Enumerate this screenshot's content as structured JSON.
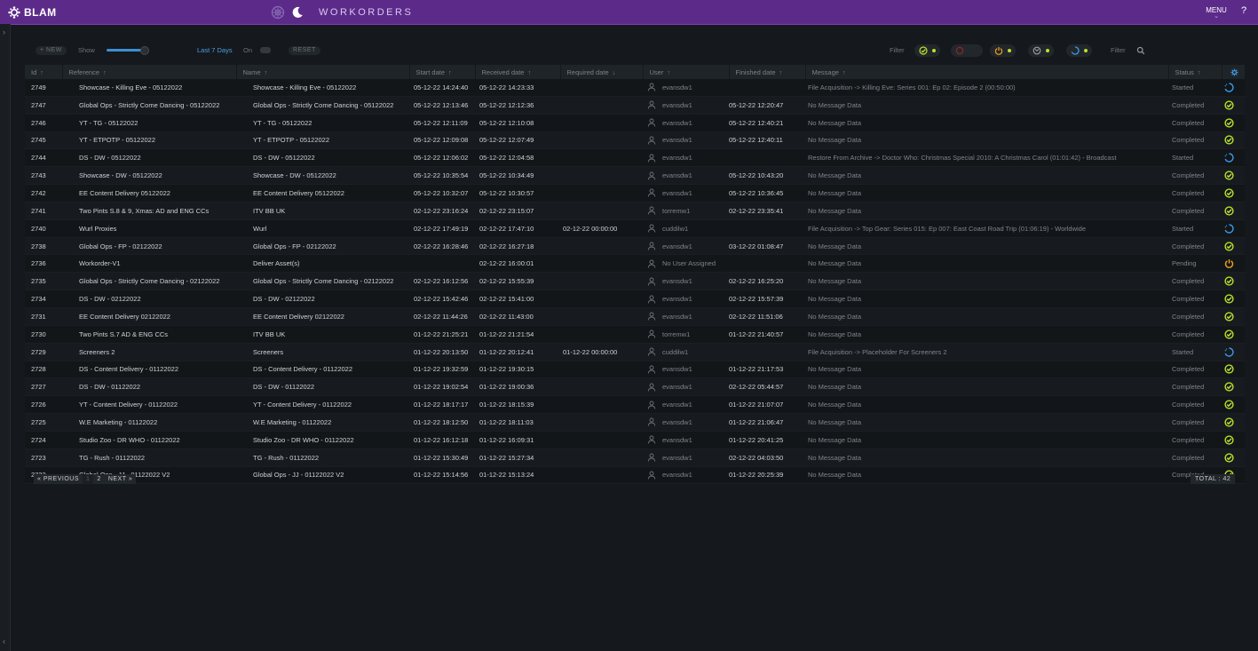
{
  "header": {
    "brand": "BLAM",
    "title": "WORKORDERS",
    "menu_label": "MENU",
    "help_label": "?"
  },
  "toolbar": {
    "new_label": "+ NEW",
    "show_label": "Show",
    "range_label": "Last 7 Days",
    "on_label": "On",
    "reset_label": "RESET",
    "filter_label": "Filter",
    "filter_search_label": "Filter"
  },
  "colors": {
    "topbar": "#5c2b8a",
    "completed": "#b9e22a",
    "started": "#3d9be9",
    "pending": "#f0a21c",
    "failed": "#d9342b"
  },
  "columns": [
    "Id",
    "Reference",
    "Name",
    "Start date",
    "Received date",
    "Required date",
    "User",
    "Finished date",
    "Message",
    "Status"
  ],
  "rows": [
    {
      "id": "2749",
      "reference": "Showcase - Killing Eve - 05122022",
      "name": "Showcase - Killing Eve - 05122022",
      "start": "05-12-22 14:24:40",
      "received": "05-12-22 14:23:33",
      "required": "",
      "user": "evansdw1",
      "finished": "",
      "message": "File Acquisition -> Killing Eve: Series 001: Ep 02: Episode 2 (00:50:00)",
      "status": "Started",
      "icon": "started"
    },
    {
      "id": "2747",
      "reference": "Global Ops - Strictly Come Dancing - 05122022",
      "name": "Global Ops - Strictly Come Dancing - 05122022",
      "start": "05-12-22 12:13:46",
      "received": "05-12-22 12:12:36",
      "required": "",
      "user": "evansdw1",
      "finished": "05-12-22 12:20:47",
      "message": "No Message Data",
      "status": "Completed",
      "icon": "completed"
    },
    {
      "id": "2746",
      "reference": "YT - TG - 05122022",
      "name": "YT - TG - 05122022",
      "start": "05-12-22 12:11:09",
      "received": "05-12-22 12:10:08",
      "required": "",
      "user": "evansdw1",
      "finished": "05-12-22 12:40:21",
      "message": "No Message Data",
      "status": "Completed",
      "icon": "completed"
    },
    {
      "id": "2745",
      "reference": "YT - ETPOTP - 05122022",
      "name": "YT - ETPOTP - 05122022",
      "start": "05-12-22 12:09:08",
      "received": "05-12-22 12:07:49",
      "required": "",
      "user": "evansdw1",
      "finished": "05-12-22 12:40:11",
      "message": "No Message Data",
      "status": "Completed",
      "icon": "completed"
    },
    {
      "id": "2744",
      "reference": "DS - DW - 05122022",
      "name": "DS - DW - 05122022",
      "start": "05-12-22 12:06:02",
      "received": "05-12-22 12:04:58",
      "required": "",
      "user": "evansdw1",
      "finished": "",
      "message": "Restore From Archive -> Doctor Who: Christmas Special 2010: A Christmas Carol (01:01:42) - Broadcast",
      "status": "Started",
      "icon": "started"
    },
    {
      "id": "2743",
      "reference": "Showcase - DW - 05122022",
      "name": "Showcase - DW - 05122022",
      "start": "05-12-22 10:35:54",
      "received": "05-12-22 10:34:49",
      "required": "",
      "user": "evansdw1",
      "finished": "05-12-22 10:43:20",
      "message": "No Message Data",
      "status": "Completed",
      "icon": "completed"
    },
    {
      "id": "2742",
      "reference": "EE Content Delivery 05122022",
      "name": "EE Content Delivery 05122022",
      "start": "05-12-22 10:32:07",
      "received": "05-12-22 10:30:57",
      "required": "",
      "user": "evansdw1",
      "finished": "05-12-22 10:36:45",
      "message": "No Message Data",
      "status": "Completed",
      "icon": "completed"
    },
    {
      "id": "2741",
      "reference": "Two Pints S.8 & 9, Xmas: AD and ENG CCs",
      "name": "ITV BB UK",
      "start": "02-12-22 23:16:24",
      "received": "02-12-22 23:15:07",
      "required": "",
      "user": "torremw1",
      "finished": "02-12-22 23:35:41",
      "message": "No Message Data",
      "status": "Completed",
      "icon": "completed"
    },
    {
      "id": "2740",
      "reference": "Wurl Proxies",
      "name": "Wurl",
      "start": "02-12-22 17:49:19",
      "received": "02-12-22 17:47:10",
      "required": "02-12-22 00:00:00",
      "user": "cuddilw1",
      "finished": "",
      "message": "File Acquisition -> Top Gear: Series 015: Ep 007: East Coast Road Trip (01:06:19) - Worldwide",
      "status": "Started",
      "icon": "started"
    },
    {
      "id": "2738",
      "reference": "Global Ops - FP - 02122022",
      "name": "Global Ops - FP - 02122022",
      "start": "02-12-22 16:28:46",
      "received": "02-12-22 16:27:18",
      "required": "",
      "user": "evansdw1",
      "finished": "03-12-22 01:08:47",
      "message": "No Message Data",
      "status": "Completed",
      "icon": "completed"
    },
    {
      "id": "2736",
      "reference": "Workorder-V1",
      "name": "Deliver Asset(s)",
      "start": "",
      "received": "02-12-22 16:00:01",
      "required": "",
      "user": "No User Assigned",
      "finished": "",
      "message": "No Message Data",
      "status": "Pending",
      "icon": "pending"
    },
    {
      "id": "2735",
      "reference": "Global Ops - Strictly Come Dancing - 02122022",
      "name": "Global Ops - Strictly Come Dancing - 02122022",
      "start": "02-12-22 16:12:56",
      "received": "02-12-22 15:55:39",
      "required": "",
      "user": "evansdw1",
      "finished": "02-12-22 16:25:20",
      "message": "No Message Data",
      "status": "Completed",
      "icon": "completed"
    },
    {
      "id": "2734",
      "reference": "DS - DW - 02122022",
      "name": "DS - DW - 02122022",
      "start": "02-12-22 15:42:46",
      "received": "02-12-22 15:41:00",
      "required": "",
      "user": "evansdw1",
      "finished": "02-12-22 15:57:39",
      "message": "No Message Data",
      "status": "Completed",
      "icon": "completed"
    },
    {
      "id": "2731",
      "reference": "EE Content Delivery 02122022",
      "name": "EE Content Delivery 02122022",
      "start": "02-12-22 11:44:26",
      "received": "02-12-22 11:43:00",
      "required": "",
      "user": "evansdw1",
      "finished": "02-12-22 11:51:06",
      "message": "No Message Data",
      "status": "Completed",
      "icon": "completed"
    },
    {
      "id": "2730",
      "reference": "Two Pints S.7 AD & ENG CCs",
      "name": "ITV BB UK",
      "start": "01-12-22 21:25:21",
      "received": "01-12-22 21:21:54",
      "required": "",
      "user": "torremw1",
      "finished": "01-12-22 21:40:57",
      "message": "No Message Data",
      "status": "Completed",
      "icon": "completed"
    },
    {
      "id": "2729",
      "reference": "Screeners 2",
      "name": "Screeners",
      "start": "01-12-22 20:13:50",
      "received": "01-12-22 20:12:41",
      "required": "01-12-22 00:00:00",
      "user": "cuddilw1",
      "finished": "",
      "message": "File Acquisition -> Placeholder For Screeners 2",
      "status": "Started",
      "icon": "started"
    },
    {
      "id": "2728",
      "reference": "DS - Content Delivery - 01122022",
      "name": "DS - Content Delivery - 01122022",
      "start": "01-12-22 19:32:59",
      "received": "01-12-22 19:30:15",
      "required": "",
      "user": "evansdw1",
      "finished": "01-12-22 21:17:53",
      "message": "No Message Data",
      "status": "Completed",
      "icon": "completed"
    },
    {
      "id": "2727",
      "reference": "DS - DW - 01122022",
      "name": "DS - DW - 01122022",
      "start": "01-12-22 19:02:54",
      "received": "01-12-22 19:00:36",
      "required": "",
      "user": "evansdw1",
      "finished": "02-12-22 05:44:57",
      "message": "No Message Data",
      "status": "Completed",
      "icon": "completed"
    },
    {
      "id": "2726",
      "reference": "YT - Content Delivery - 01122022",
      "name": "YT - Content Delivery - 01122022",
      "start": "01-12-22 18:17:17",
      "received": "01-12-22 18:15:39",
      "required": "",
      "user": "evansdw1",
      "finished": "01-12-22 21:07:07",
      "message": "No Message Data",
      "status": "Completed",
      "icon": "completed"
    },
    {
      "id": "2725",
      "reference": "W.E Marketing - 01122022",
      "name": "W.E Marketing - 01122022",
      "start": "01-12-22 18:12:50",
      "received": "01-12-22 18:11:03",
      "required": "",
      "user": "evansdw1",
      "finished": "01-12-22 21:06:47",
      "message": "No Message Data",
      "status": "Completed",
      "icon": "completed"
    },
    {
      "id": "2724",
      "reference": "Studio Zoo - DR WHO - 01122022",
      "name": "Studio Zoo - DR WHO - 01122022",
      "start": "01-12-22 16:12:18",
      "received": "01-12-22 16:09:31",
      "required": "",
      "user": "evansdw1",
      "finished": "01-12-22 20:41:25",
      "message": "No Message Data",
      "status": "Completed",
      "icon": "completed"
    },
    {
      "id": "2723",
      "reference": "TG - Rush - 01122022",
      "name": "TG - Rush - 01122022",
      "start": "01-12-22 15:30:49",
      "received": "01-12-22 15:27:34",
      "required": "",
      "user": "evansdw1",
      "finished": "02-12-22 04:03:50",
      "message": "No Message Data",
      "status": "Completed",
      "icon": "completed"
    },
    {
      "id": "2722",
      "reference": "Global Ops - JJ - 01122022 V2",
      "name": "Global Ops - JJ - 01122022 V2",
      "start": "01-12-22 15:14:56",
      "received": "01-12-22 15:13:24",
      "required": "",
      "user": "evansdw1",
      "finished": "01-12-22 20:25:39",
      "message": "No Message Data",
      "status": "Completed",
      "icon": "completed"
    }
  ],
  "pagination": {
    "prev_label": "« PREVIOUS",
    "pages": [
      "1",
      "2"
    ],
    "next_label": "NEXT »",
    "total_label": "TOTAL : 42"
  }
}
